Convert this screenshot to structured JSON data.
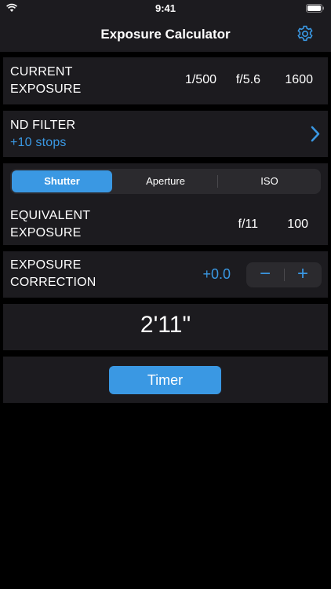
{
  "status": {
    "time": "9:41"
  },
  "nav": {
    "title": "Exposure Calculator"
  },
  "current": {
    "label_line1": "CURRENT",
    "label_line2": "EXPOSURE",
    "shutter": "1/500",
    "aperture": "f/5.6",
    "iso": "1600"
  },
  "nd": {
    "label": "ND FILTER",
    "value": "+10 stops"
  },
  "segment": {
    "options": [
      "Shutter",
      "Aperture",
      "ISO"
    ],
    "selected": "Shutter"
  },
  "equivalent": {
    "label_line1": "EQUIVALENT",
    "label_line2": "EXPOSURE",
    "aperture": "f/11",
    "iso": "100"
  },
  "correction": {
    "label_line1": "EXPOSURE",
    "label_line2": "CORRECTION",
    "value": "+0.0",
    "minus": "−",
    "plus": "+"
  },
  "result": {
    "time": "2'11\""
  },
  "timer": {
    "label": "Timer"
  },
  "colors": {
    "accent": "#3a98e3",
    "card": "#1c1b1f",
    "background": "#000000"
  }
}
